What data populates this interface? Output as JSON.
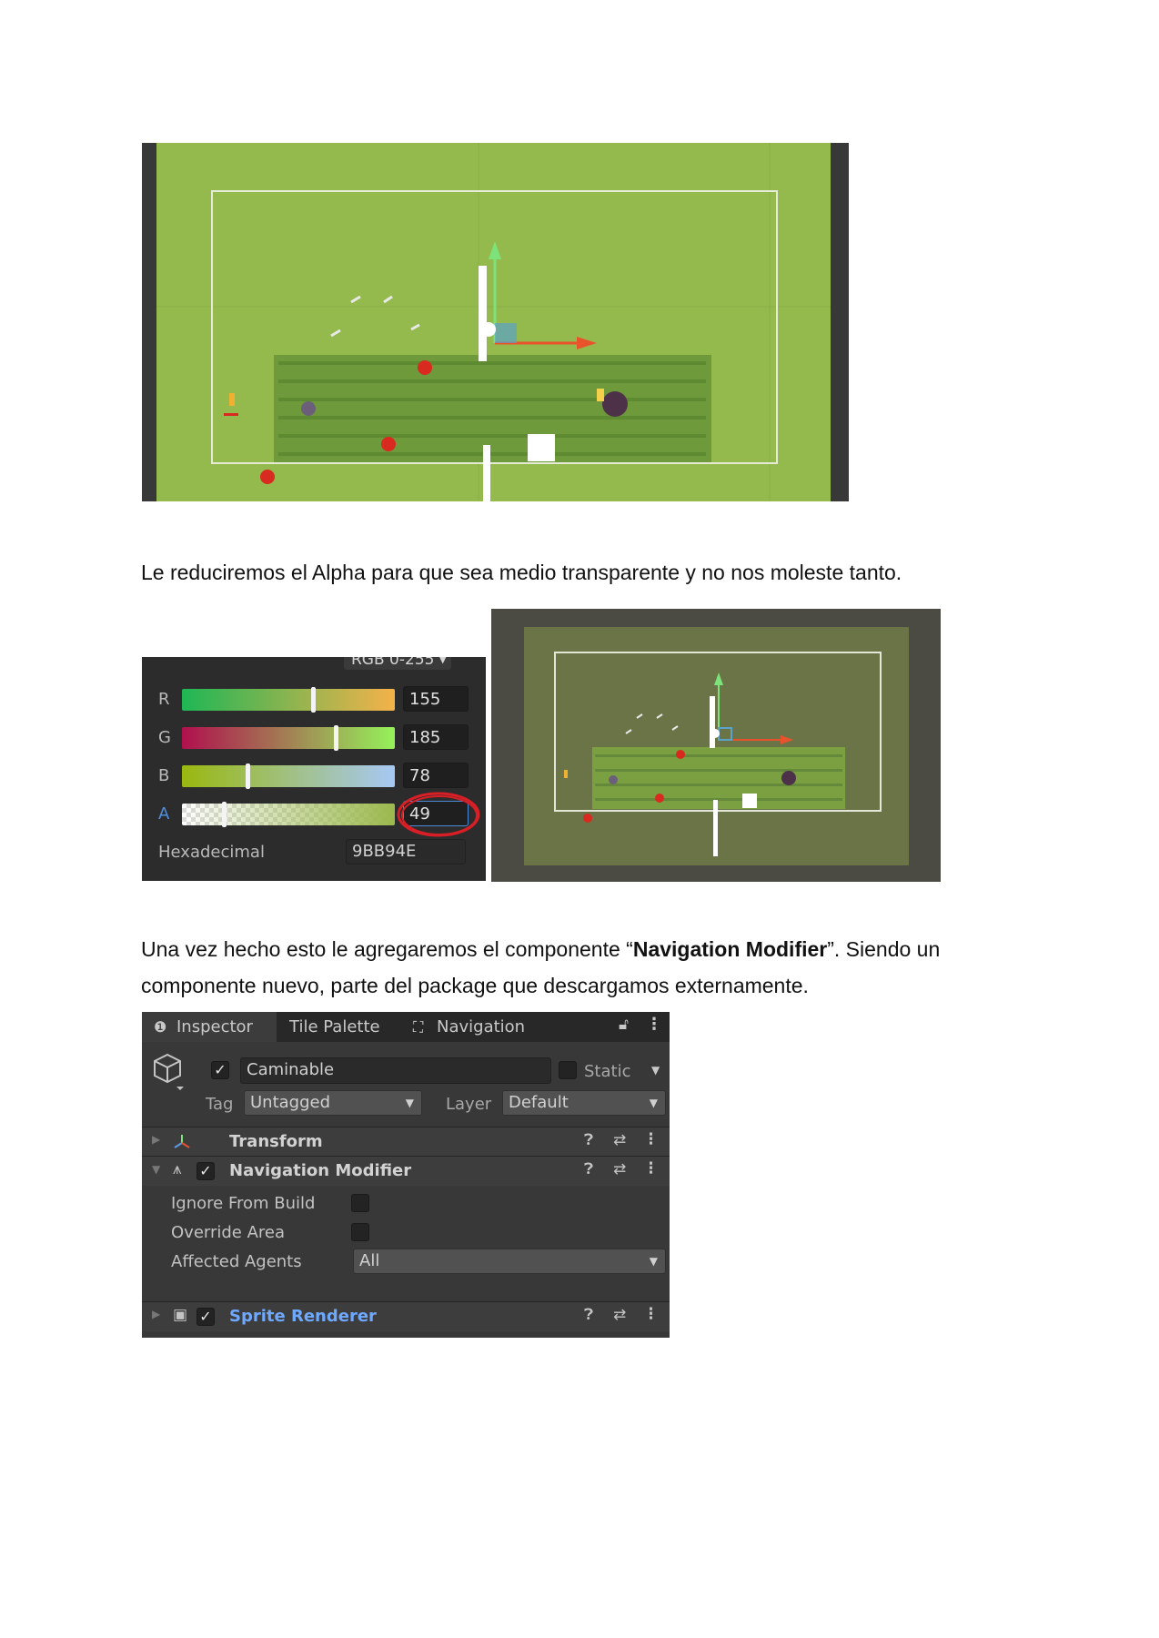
{
  "paragraphs": {
    "p1": "Le reduciremos el Alpha para que sea medio transparente y no nos moleste tanto.",
    "p2_a": "Una vez hecho esto le agregaremos el componente “",
    "p2_bold": "Navigation Modifier",
    "p2_b": "”. Siendo un",
    "p2_c": "componente nuevo, parte del package que descargamos externamente."
  },
  "color_panel": {
    "mode_label": "RGB 0-255",
    "channels": [
      {
        "label": "R",
        "value": "155",
        "fraction": 0.608
      },
      {
        "label": "G",
        "value": "185",
        "fraction": 0.725
      },
      {
        "label": "B",
        "value": "78",
        "fraction": 0.306
      },
      {
        "label": "A",
        "value": "49",
        "fraction": 0.192
      }
    ],
    "hex_label": "Hexadecimal",
    "hex_value": "9BB94E"
  },
  "inspector": {
    "tabs": [
      "Inspector",
      "Tile Palette",
      "Navigation"
    ],
    "object_name": "Caminable",
    "object_active": true,
    "static_label": "Static",
    "tag_label": "Tag",
    "tag_value": "Untagged",
    "layer_label": "Layer",
    "layer_value": "Default",
    "components": {
      "transform": "Transform",
      "nav_modifier": "Navigation Modifier",
      "sprite_renderer": "Sprite Renderer"
    },
    "nav_props": {
      "ignore_from_build": "Ignore From Build",
      "override_area": "Override Area",
      "affected_agents": "Affected Agents",
      "affected_agents_value": "All"
    }
  },
  "colors": {
    "ground_green": "#94ba4d",
    "grass_tile": "#6f9a3c",
    "gizmo_green": "#7ee27b",
    "gizmo_red": "#e8532c",
    "sprite_renderer_blue": "#6fa8ff",
    "annotation_red": "#d81f26"
  }
}
